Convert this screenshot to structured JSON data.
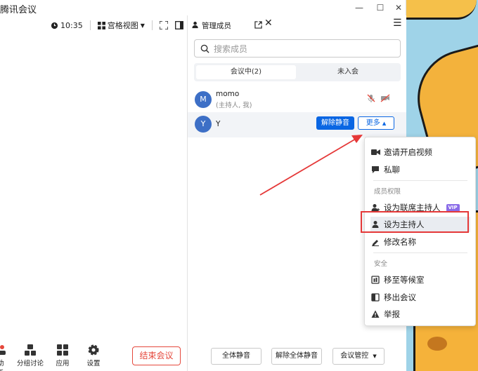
{
  "app": {
    "title": "腾讯会议"
  },
  "toolbar": {
    "time": "10:35",
    "view_label": "宫格视图"
  },
  "bottom": {
    "assistant": "助手",
    "breakout": "分组讨论",
    "apps": "应用",
    "settings": "设置",
    "end": "结束会议"
  },
  "panel": {
    "title": "管理成员",
    "search_placeholder": "搜索成员",
    "tab_in_meeting": "会议中(2)",
    "tab_not_joined": "未入会",
    "members": [
      {
        "initial": "M",
        "name": "momo",
        "role": "(主持人, 我)"
      },
      {
        "initial": "Y",
        "name": "Y",
        "unmute": "解除静音",
        "more": "更多"
      }
    ],
    "mute_all": "全体静音",
    "unmute_all": "解除全体静音",
    "control": "会议管控"
  },
  "menu": {
    "invite_video": "邀请开启视频",
    "private_chat": "私聊",
    "section_perm": "成员权限",
    "set_cohost": "设为联席主持人",
    "vip": "VIP",
    "set_host": "设为主持人",
    "rename": "修改名称",
    "section_security": "安全",
    "move_waiting": "移至等候室",
    "remove": "移出会议",
    "report": "举报"
  },
  "colors": {
    "accent": "#0a66e3",
    "danger": "#e5483c",
    "highlight_box": "#e53838"
  }
}
